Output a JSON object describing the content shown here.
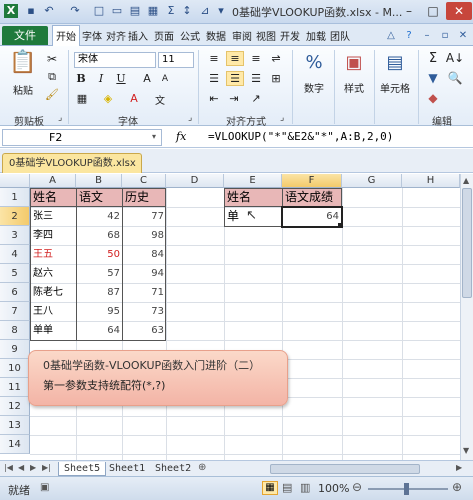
{
  "window": {
    "title": "0基础学VLOOKUP函数.xlsx - M..."
  },
  "ribbon_tabs": [
    "开始",
    "插入",
    "页面",
    "公式",
    "数据",
    "审阅",
    "视图",
    "开发",
    "加载",
    "团队"
  ],
  "ribbon_tabs_vertical": [
    "文件",
    "开始",
    "字体",
    "对齐",
    "插入",
    "页面",
    "公式",
    "数据",
    "审阅",
    "视图",
    "开发",
    "加载",
    "团队"
  ],
  "file_tab": "文件",
  "ribbon": {
    "paste_label": "粘贴",
    "clipboard_label": "剪贴板",
    "font_name": "宋体",
    "font_size": "11",
    "font_group_label": "字体",
    "align_group_label": "对齐方式",
    "number_label": "数字",
    "style_label": "样式",
    "cells_label": "单元格",
    "edit_label": "编辑"
  },
  "formula_bar": {
    "name_box": "F2",
    "fx": "fx",
    "formula": "=VLOOKUP(\"*\"&E2&\"*\",A:B,2,0)"
  },
  "doc_tab": "0基础学VLOOKUP函数.xlsx",
  "columns": [
    "A",
    "B",
    "C",
    "D",
    "E",
    "F",
    "G",
    "H"
  ],
  "rows": [
    "1",
    "2",
    "3",
    "4",
    "5",
    "6",
    "7",
    "8",
    "9",
    "10",
    "11",
    "12",
    "13",
    "14"
  ],
  "table1": {
    "headers": [
      "姓名",
      "语文",
      "历史"
    ],
    "rows": [
      {
        "name": "张三",
        "chinese": "42",
        "history": "77"
      },
      {
        "name": "李四",
        "chinese": "68",
        "history": "98"
      },
      {
        "name": "王五",
        "chinese": "50",
        "history": "84"
      },
      {
        "name": "赵六",
        "chinese": "57",
        "history": "94"
      },
      {
        "name": "陈老七",
        "chinese": "87",
        "history": "71"
      },
      {
        "name": "王八",
        "chinese": "95",
        "history": "73"
      },
      {
        "name": "单单",
        "chinese": "64",
        "history": "63"
      }
    ]
  },
  "table2": {
    "headers": [
      "姓名",
      "语文成绩"
    ],
    "row": {
      "name": "单",
      "score": "64"
    }
  },
  "banner": {
    "line1": "0基础学函数-VLOOKUP函数入门进阶（二）",
    "line2": "第一参数支持统配符(*,?)"
  },
  "sheets": [
    "Sheet5",
    "Sheet1",
    "Sheet2"
  ],
  "status": {
    "ready": "就绪",
    "zoom": "100%"
  },
  "colors": {
    "file_tab": "#1f7a3c",
    "header_fill": "#e8b7b7",
    "banner": "#f3b4a6",
    "red_text": "#d22020"
  }
}
